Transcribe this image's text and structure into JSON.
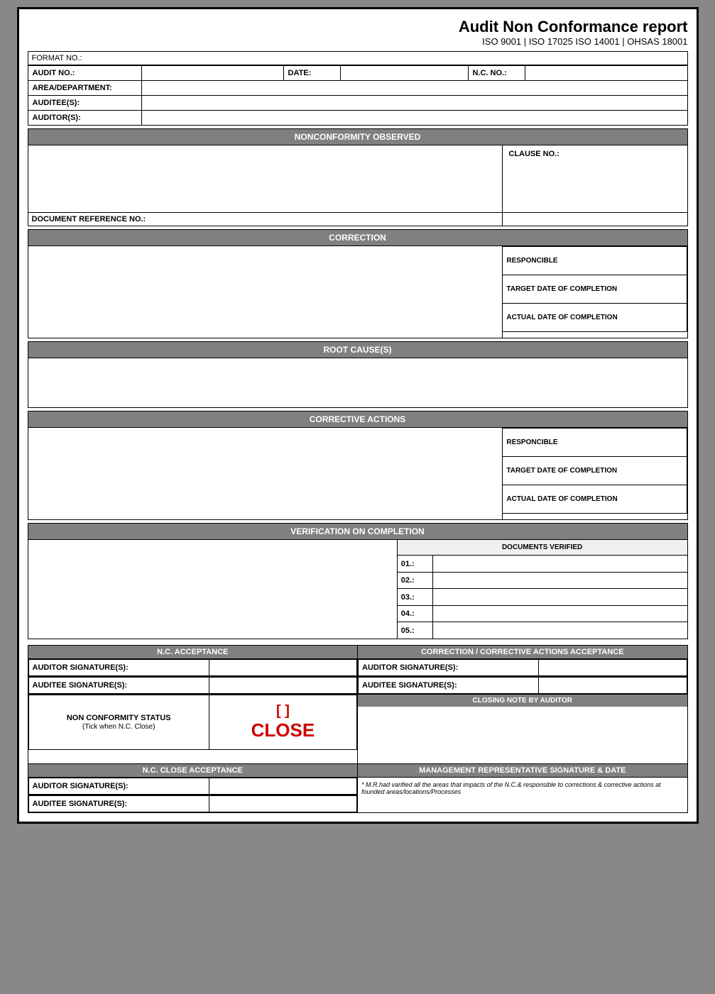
{
  "header": {
    "title": "Audit Non Conformance report",
    "subtitle": "ISO 9001 | ISO 17025 ISO 14001 | OHSAS 18001"
  },
  "format_no_label": "FORMAT NO.:",
  "info": {
    "audit_no_label": "AUDIT NO.:",
    "date_label": "DATE:",
    "nc_no_label": "N.C. NO.:",
    "area_label": "AREA/DEPARTMENT:",
    "auditee_label": "AUDITEE(S):",
    "auditor_label": "AUDITOR(S):"
  },
  "sections": {
    "nonconformity": "NONCONFORMITY OBSERVED",
    "clause_no_label": "CLAUSE NO.:",
    "doc_ref_label": "DOCUMENT REFERENCE NO.:",
    "correction": "CORRECTION",
    "responsible_label": "RESPONCIBLE",
    "target_date_label": "TARGET DATE OF COMPLETION",
    "actual_date_label": "ACTUAL DATE OF COMPLETION",
    "root_cause": "ROOT CAUSE(S)",
    "corrective_actions": "CORRECTIVE ACTIONS",
    "verification": "VERIFICATION ON COMPLETION",
    "documents_verified_label": "DOCUMENTS VERIFIED",
    "doc_items": [
      "01.:",
      "02.:",
      "03.:",
      "04.:",
      "05.:"
    ]
  },
  "acceptance": {
    "nc_acceptance_label": "N.C. ACCEPTANCE",
    "correction_acceptance_label": "CORRECTION / CORRECTIVE ACTIONS ACCEPTANCE",
    "auditor_sig_label": "AUDITOR SIGNATURE(S):",
    "auditee_sig_label": "AUDITEE SIGNATURE(S):",
    "non_conformity_status_label": "NON CONFORMITY STATUS",
    "tick_note": "(Tick when N.C. Close)",
    "close_bracket": "[        ]",
    "close_text": "CLOSE",
    "closing_note_label": "CLOSING NOTE BY AUDITOR",
    "nc_close_acceptance_label": "N.C. CLOSE ACCEPTANCE",
    "mgmt_rep_label": "MANAGEMENT REPRESENTATIVE SIGNATURE & DATE",
    "footer_note": "* M.R.had varified all the areas that impacts of the N.C.& responsible to corrections & corrective actions at founded areas/locations/Processes"
  }
}
